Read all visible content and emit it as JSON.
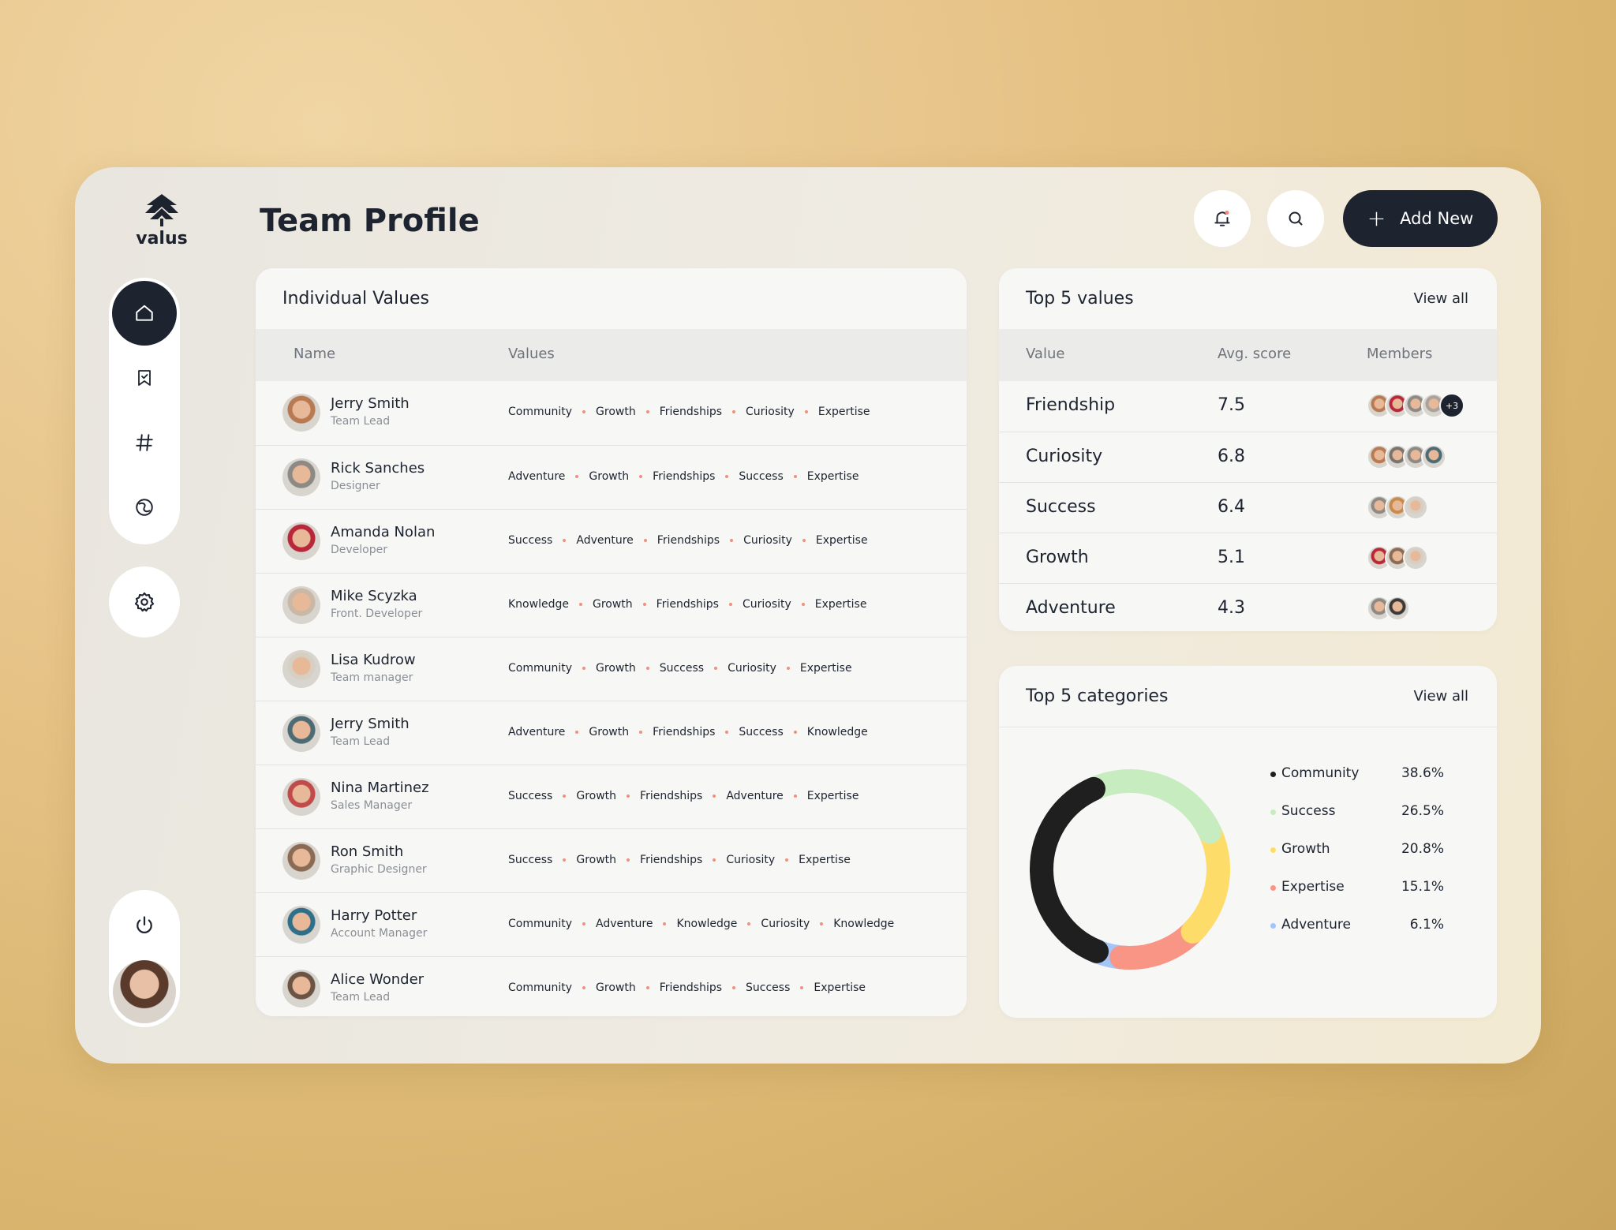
{
  "brand": {
    "name": "valus"
  },
  "header": {
    "title": "Team Profile",
    "add_button": "Add New"
  },
  "sidebar": {
    "items": [
      {
        "icon": "home-icon",
        "active": true
      },
      {
        "icon": "bookmark-icon",
        "active": false
      },
      {
        "icon": "hashtag-icon",
        "active": false
      },
      {
        "icon": "swirl-icon",
        "active": false
      }
    ]
  },
  "individual_values": {
    "title": "Individual Values",
    "columns": [
      "Name",
      "Values"
    ],
    "rows": [
      {
        "name": "Jerry Smith",
        "role": "Team Lead",
        "values": [
          "Community",
          "Growth",
          "Friendships",
          "Curiosity",
          "Expertise"
        ],
        "avatar": "#b77a52"
      },
      {
        "name": "Rick Sanches",
        "role": "Designer",
        "values": [
          "Adventure",
          "Growth",
          "Friendships",
          "Success",
          "Expertise"
        ],
        "avatar": "#8d8a86"
      },
      {
        "name": "Amanda Nolan",
        "role": "Developer",
        "values": [
          "Success",
          "Adventure",
          "Friendships",
          "Curiosity",
          "Expertise"
        ],
        "avatar": "#b8283a"
      },
      {
        "name": "Mike Scyzka",
        "role": "Front. Developer",
        "values": [
          "Knowledge",
          "Growth",
          "Friendships",
          "Curiosity",
          "Expertise"
        ],
        "avatar": "#c9b8a6"
      },
      {
        "name": "Lisa Kudrow",
        "role": "Team manager",
        "values": [
          "Community",
          "Growth",
          "Success",
          "Curiosity",
          "Expertise"
        ],
        "avatar": "#d6cfc4"
      },
      {
        "name": "Jerry Smith",
        "role": "Team Lead",
        "values": [
          "Adventure",
          "Growth",
          "Friendships",
          "Success",
          "Knowledge"
        ],
        "avatar": "#4d6b74"
      },
      {
        "name": "Nina Martinez",
        "role": "Sales Manager",
        "values": [
          "Success",
          "Growth",
          "Friendships",
          "Adventure",
          "Expertise"
        ],
        "avatar": "#c14b4b"
      },
      {
        "name": "Ron Smith",
        "role": "Graphic Designer",
        "values": [
          "Success",
          "Growth",
          "Friendships",
          "Curiosity",
          "Expertise"
        ],
        "avatar": "#8b6b55"
      },
      {
        "name": "Harry Potter",
        "role": "Account Manager",
        "values": [
          "Community",
          "Adventure",
          "Knowledge",
          "Curiosity",
          "Knowledge"
        ],
        "avatar": "#2f6f8a"
      },
      {
        "name": "Alice Wonder",
        "role": "Team Lead",
        "values": [
          "Community",
          "Growth",
          "Friendships",
          "Success",
          "Expertise"
        ],
        "avatar": "#6c5444"
      }
    ]
  },
  "top_values": {
    "title": "Top 5 values",
    "view_all": "View all",
    "columns": [
      "Value",
      "Avg. score",
      "Members"
    ],
    "rows": [
      {
        "value": "Friendship",
        "score": "7.5",
        "members": [
          "#b77a52",
          "#b8283a",
          "#8d8a86",
          "#a9a39a"
        ],
        "more": "+3"
      },
      {
        "value": "Curiosity",
        "score": "6.8",
        "members": [
          "#b77a52",
          "#7a7470",
          "#8d8a86",
          "#4d6b74"
        ],
        "more": ""
      },
      {
        "value": "Success",
        "score": "6.4",
        "members": [
          "#8d8a86",
          "#c98a4a",
          "#d6cfc4"
        ],
        "more": ""
      },
      {
        "value": "Growth",
        "score": "5.1",
        "members": [
          "#b8283a",
          "#8b6b55",
          "#d6cfc4"
        ],
        "more": ""
      },
      {
        "value": "Adventure",
        "score": "4.3",
        "members": [
          "#8d8a86",
          "#3a3a3a"
        ],
        "more": ""
      }
    ]
  },
  "top_categories": {
    "title": "Top 5 categories",
    "view_all": "View all",
    "items": [
      {
        "label": "Community",
        "value": "38.6%",
        "pct": 38.6,
        "color": "#1f1f1f"
      },
      {
        "label": "Success",
        "value": "26.5%",
        "pct": 26.5,
        "color": "#c7ecbf"
      },
      {
        "label": "Growth",
        "value": "20.8%",
        "pct": 20.8,
        "color": "#fddc6a"
      },
      {
        "label": "Expertise",
        "value": "15.1%",
        "pct": 15.1,
        "color": "#f99585"
      },
      {
        "label": "Adventure",
        "value": "6.1%",
        "pct": 6.1,
        "color": "#a4c5f7"
      }
    ]
  }
}
